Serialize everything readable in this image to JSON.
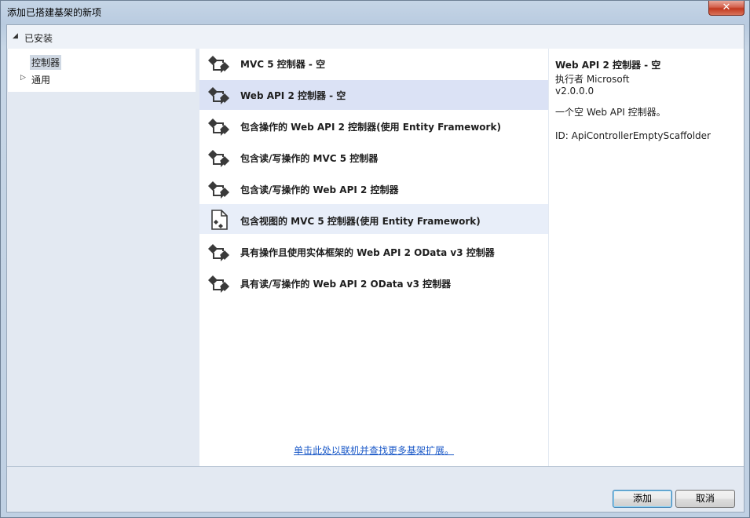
{
  "window": {
    "title": "添加已搭建基架的新项",
    "close_label": "✕"
  },
  "section": {
    "arrow": "◢",
    "label": "已安装"
  },
  "tree": {
    "selected_label": "控制器",
    "expander": "▷",
    "general_label": "通用"
  },
  "templates": [
    {
      "label": "MVC 5 控制器 - 空",
      "icon": "controller-icon"
    },
    {
      "label": "Web API 2 控制器 - 空",
      "icon": "controller-icon"
    },
    {
      "label": "包含操作的 Web API 2 控制器(使用 Entity Framework)",
      "icon": "controller-icon"
    },
    {
      "label": "包含读/写操作的 MVC 5 控制器",
      "icon": "controller-icon"
    },
    {
      "label": "包含读/写操作的 Web API 2 控制器",
      "icon": "controller-icon"
    },
    {
      "label": "包含视图的 MVC 5 控制器(使用 Entity Framework)",
      "icon": "view-file-icon"
    },
    {
      "label": "具有操作且使用实体框架的 Web API 2 OData v3 控制器",
      "icon": "controller-icon"
    },
    {
      "label": "具有读/写操作的 Web API 2 OData v3 控制器",
      "icon": "controller-icon"
    }
  ],
  "selected_index": 1,
  "online_link": "单击此处以联机并查找更多基架扩展。",
  "details": {
    "name": "Web API 2 控制器 - 空",
    "author": "执行者 Microsoft",
    "version": "v2.0.0.0",
    "description": "一个空 Web API 控制器。",
    "id": "ID: ApiControllerEmptyScaffolder"
  },
  "buttons": {
    "add": "添加",
    "cancel": "取消"
  }
}
